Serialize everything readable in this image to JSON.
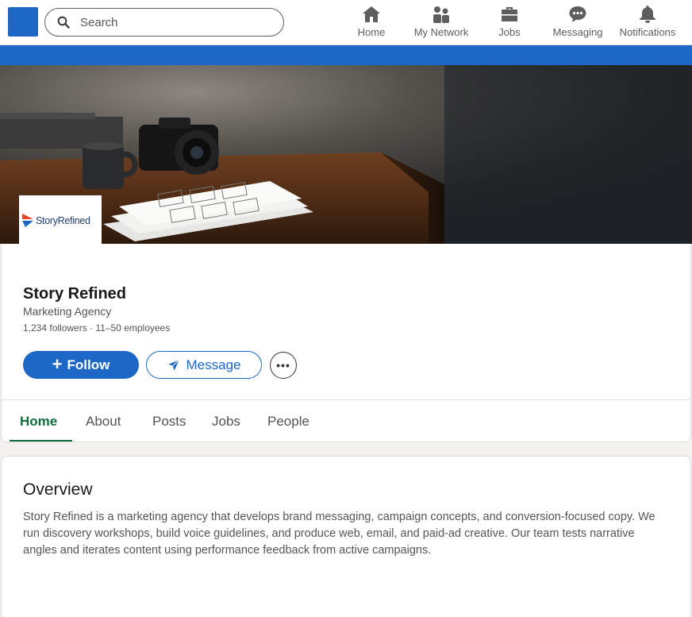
{
  "nav": {
    "search_placeholder": "Search",
    "items": [
      {
        "label": "Home",
        "icon": "home-icon"
      },
      {
        "label": "My Network",
        "icon": "people-icon"
      },
      {
        "label": "Jobs",
        "icon": "briefcase-icon"
      },
      {
        "label": "Messaging",
        "icon": "chat-icon"
      },
      {
        "label": "Notifications",
        "icon": "bell-icon"
      }
    ]
  },
  "company": {
    "logo_text": "StoryRefined",
    "name": "Story Refined",
    "type": "Marketing Agency",
    "stats": "1,234 followers · 11–50 employees"
  },
  "actions": {
    "follow_label": "Follow",
    "message_label": "Message",
    "more_label": "•••"
  },
  "tabs": [
    {
      "label": "Home",
      "active": true
    },
    {
      "label": "About",
      "active": false
    },
    {
      "label": "Posts",
      "active": false
    },
    {
      "label": "Jobs",
      "active": false
    },
    {
      "label": "People",
      "active": false
    }
  ],
  "overview": {
    "title": "Overview",
    "body": "Story Refined is a marketing agency that develops brand messaging, campaign concepts, and conversion-focused copy. We run discovery workshops, build voice guidelines, and produce web, email, and paid-ad creative. Our team tests narrative angles and iterates content using performance feedback from active campaigns."
  },
  "colors": {
    "brand_blue": "#1d68c7",
    "active_tab": "#126d3d",
    "logo_red": "#e8452c"
  }
}
